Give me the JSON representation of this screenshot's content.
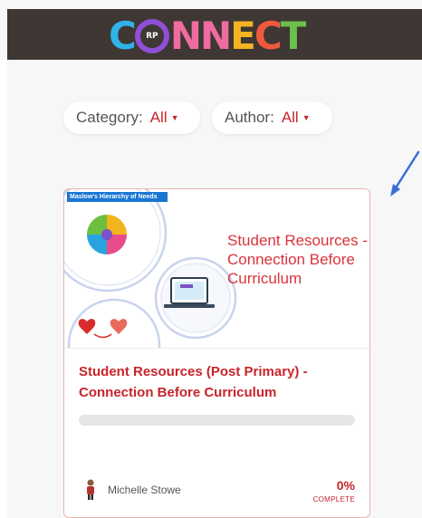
{
  "header": {
    "logo": {
      "letters": [
        "C",
        "",
        "NN",
        "E",
        "C",
        "T"
      ],
      "badge": "RP",
      "colors": {
        "C1": "#2fb3e8",
        "NN": "#f06ba0",
        "E": "#f5b323",
        "C2": "#ef5a3c",
        "T": "#6cc04a",
        "ring": "#8e4fd6"
      }
    }
  },
  "filters": {
    "category": {
      "label": "Category:",
      "value": "All"
    },
    "author": {
      "label": "Author:",
      "value": "All"
    }
  },
  "course_card": {
    "thumbnail": {
      "banner": "Maslow's Hierarchy of Needs",
      "title_lines": [
        "Student Resources -",
        "Connection Before",
        "Curriculum"
      ]
    },
    "title": "Student Resources (Post Primary) - Connection Before Curriculum",
    "progress_percent": 0,
    "author": "Michelle Stowe",
    "percent_label": "0%",
    "complete_label": "COMPLETE"
  },
  "colors": {
    "accent": "#c8242b",
    "header_bg": "#3e3733",
    "pointer_arrow": "#3b6fd4"
  },
  "icons": {
    "pointer": "arrow-pointer-icon",
    "caret": "caret-down-icon",
    "avatar": "author-avatar-icon"
  }
}
